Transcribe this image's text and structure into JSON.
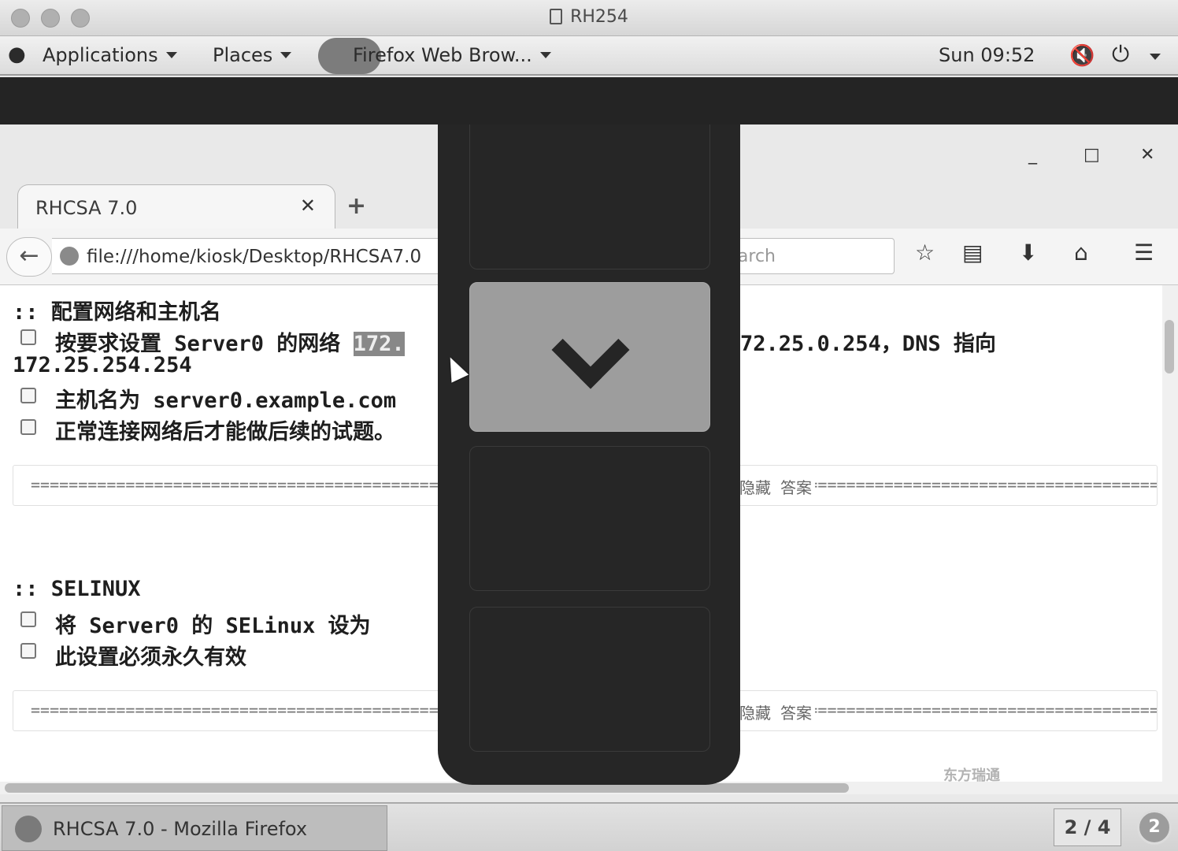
{
  "window": {
    "title": "RH254"
  },
  "gnome": {
    "applications": "Applications",
    "places": "Places",
    "active_app": "Firefox Web Brow...",
    "clock": "Sun 09:52"
  },
  "browser": {
    "tab_title": "RHCSA 7.0",
    "url": "file:///home/kiosk/Desktop/RHCSA7.0",
    "search_placeholder": "Search"
  },
  "content": {
    "sec1_title": ":: 配置网络和主机名",
    "sec1_item1_a": "按要求设置 Server0 的网络 ",
    "sec1_item1_sel": "172.",
    "sec1_item1_b": "72.25.0.254，DNS 指向",
    "sec1_item1_c": "172.25.254.254",
    "sec1_item2": "主机名为 server0.example.com",
    "sec1_item3": "正常连接网络后才能做后续的试题。",
    "rule_dashes": "=================================================================================================================================",
    "rule_answer": "隐藏 答案",
    "sec2_title": ":: SELINUX",
    "sec2_item1": "将 Server0 的 SELinux 设为",
    "sec2_item2": "此设置必须永久有效"
  },
  "taskbar": {
    "window_label": "RHCSA 7.0 - Mozilla Firefox",
    "workspace": "2 / 4",
    "notifications": "2"
  },
  "watermark": "东方瑞通"
}
